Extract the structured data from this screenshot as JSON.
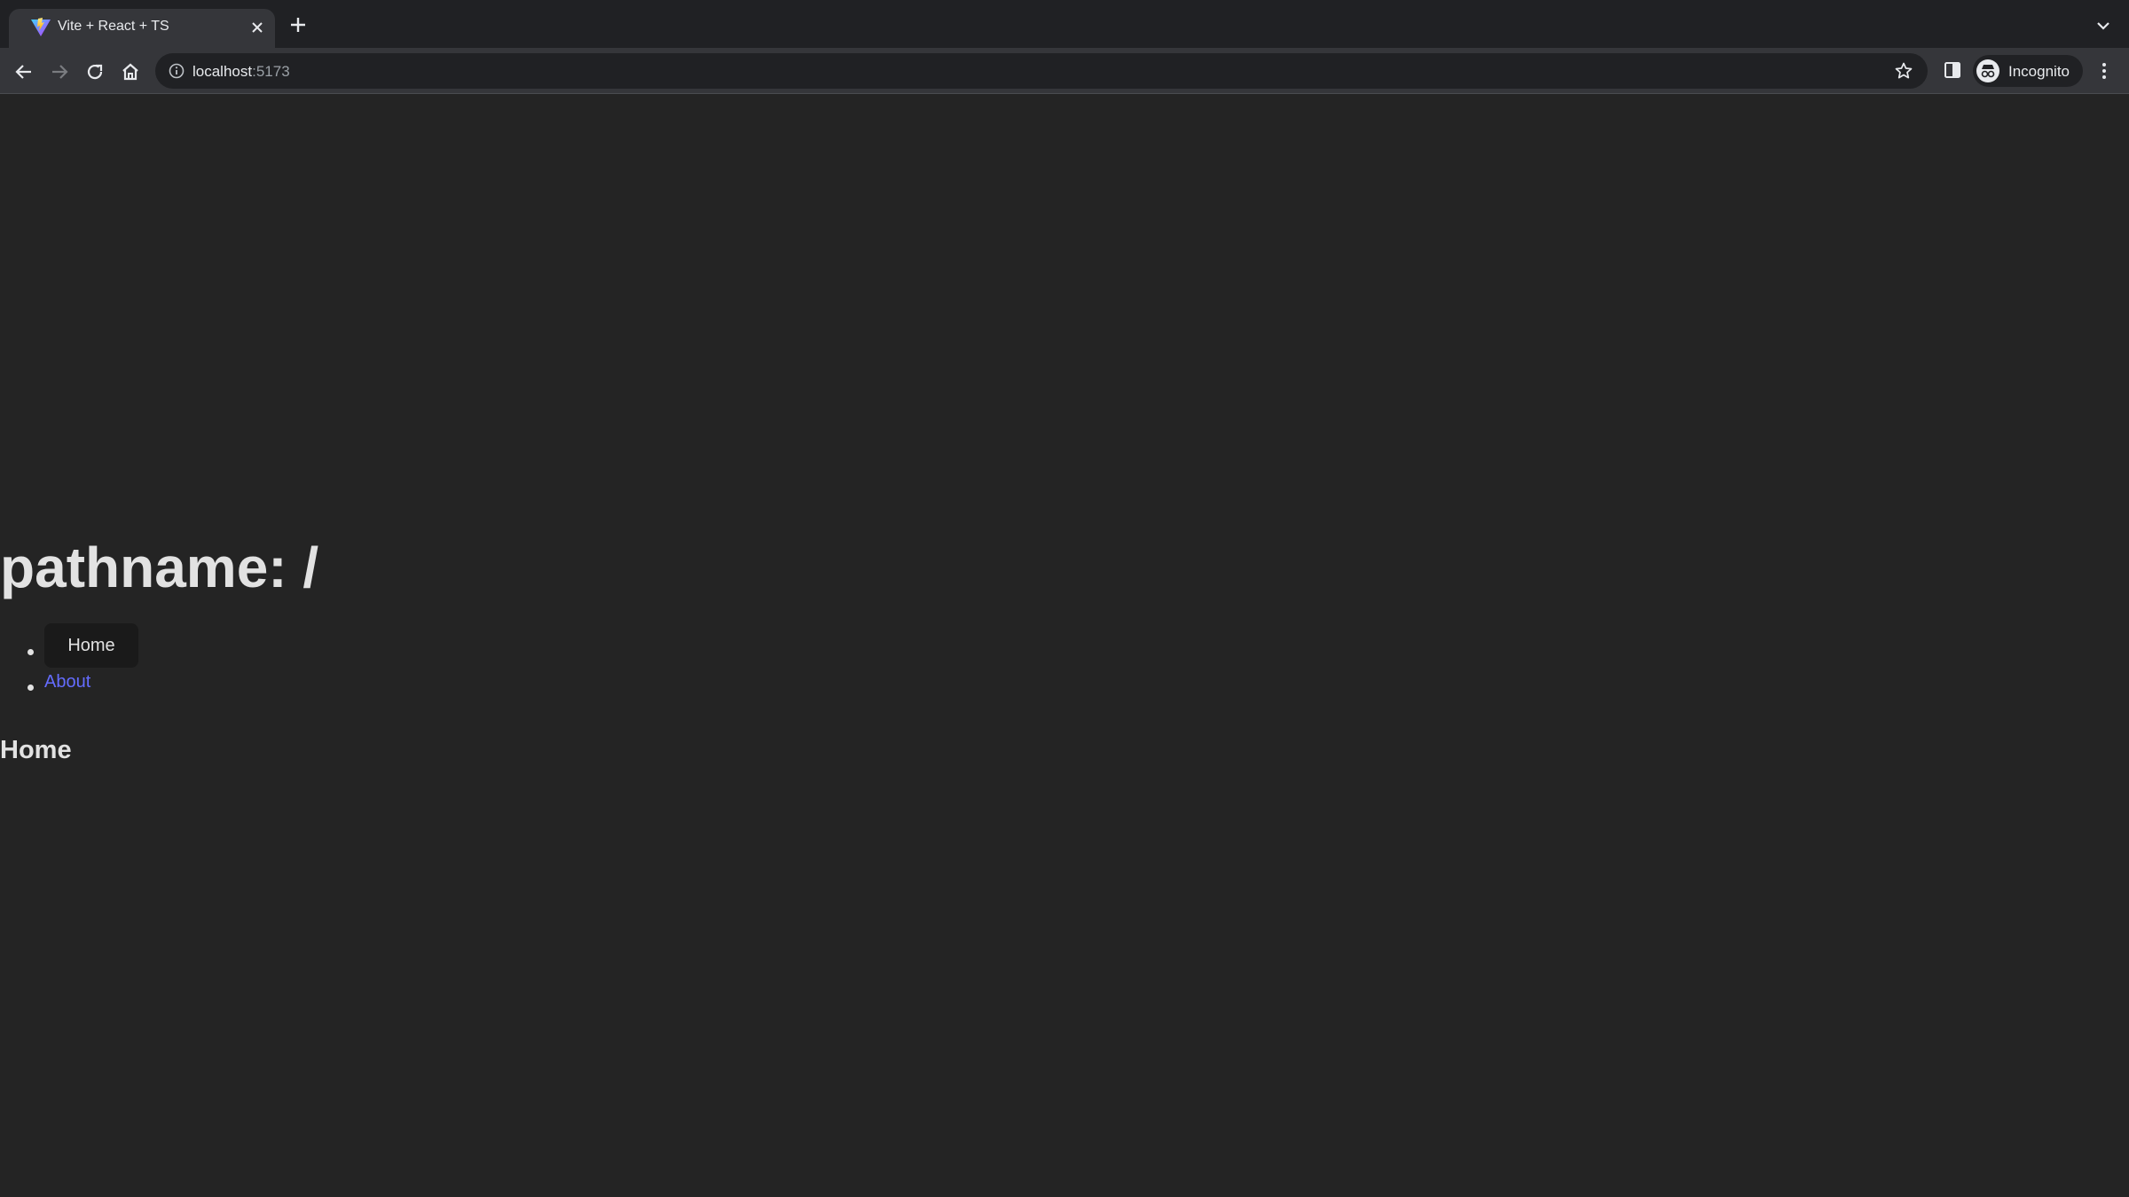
{
  "browser": {
    "tab": {
      "title": "Vite + React + TS",
      "favicon": "vite-logo-icon"
    },
    "address_bar": {
      "host": "localhost",
      "port": ":5173"
    },
    "profile": {
      "label": "Incognito"
    },
    "icons": {
      "back": "back-arrow-icon",
      "forward": "forward-arrow-icon",
      "reload": "reload-icon",
      "home": "home-icon",
      "info": "info-icon",
      "bookmark": "star-icon",
      "side_panel": "side-panel-icon",
      "menu": "kebab-menu-icon",
      "new_tab": "plus-icon",
      "tab_search": "chevron-down-icon",
      "close_tab": "close-icon"
    }
  },
  "page": {
    "pathname_heading": "pathname: /",
    "nav": {
      "items": [
        {
          "label": "Home",
          "type": "button"
        },
        {
          "label": "About",
          "type": "link"
        }
      ]
    },
    "content_heading": "Home"
  },
  "colors": {
    "page_background": "#242424",
    "link": "#646cff",
    "button_background": "#1a1a1a",
    "chrome_tabstrip": "#202124",
    "chrome_toolbar": "#35363a"
  }
}
